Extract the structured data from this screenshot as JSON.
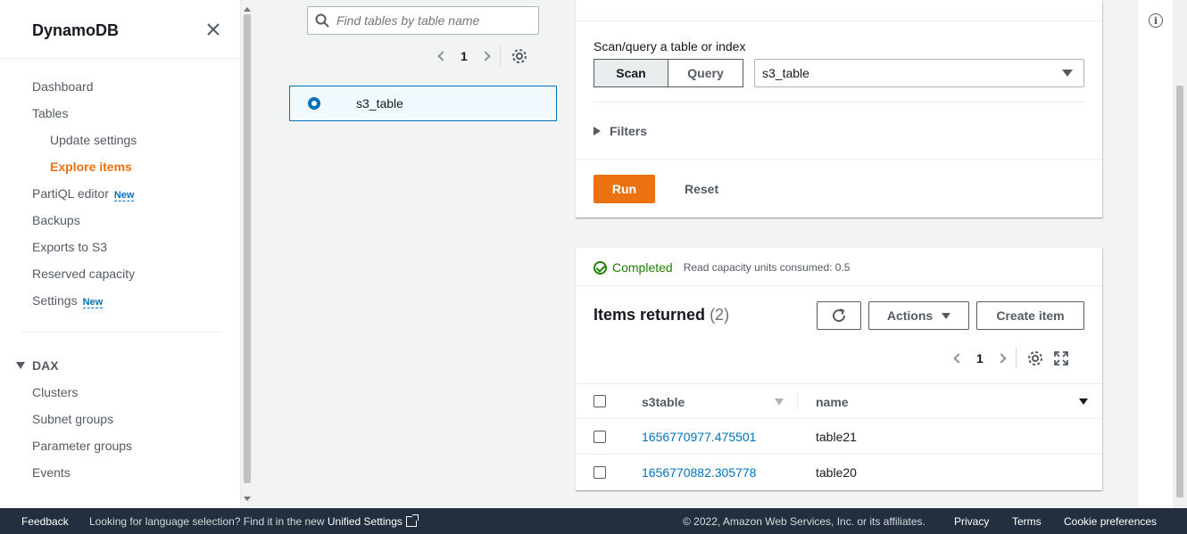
{
  "sidebar": {
    "title": "DynamoDB",
    "items": [
      {
        "label": "Dashboard"
      },
      {
        "label": "Tables"
      },
      {
        "label": "Update settings"
      },
      {
        "label": "Explore items"
      },
      {
        "label": "PartiQL editor",
        "badge": "New"
      },
      {
        "label": "Backups"
      },
      {
        "label": "Exports to S3"
      },
      {
        "label": "Reserved capacity"
      },
      {
        "label": "Settings",
        "badge": "New"
      }
    ],
    "dax_section": "DAX",
    "dax_items": [
      {
        "label": "Clusters"
      },
      {
        "label": "Subnet groups"
      },
      {
        "label": "Parameter groups"
      },
      {
        "label": "Events"
      }
    ]
  },
  "tables_panel": {
    "search_placeholder": "Find tables by table name",
    "page": "1",
    "selected_table": "s3_table"
  },
  "query_panel": {
    "label": "Scan/query a table or index",
    "scan_label": "Scan",
    "query_label": "Query",
    "selected_source": "s3_table",
    "filters_label": "Filters",
    "run_label": "Run",
    "reset_label": "Reset"
  },
  "results": {
    "status": "Completed",
    "rcu_text": "Read capacity units consumed: 0.5",
    "title": "Items returned",
    "count": "(2)",
    "actions_label": "Actions",
    "create_label": "Create item",
    "page": "1",
    "columns": [
      "s3table",
      "name"
    ],
    "rows": [
      {
        "s3table": "1656770977.475501",
        "name": "table21"
      },
      {
        "s3table": "1656770882.305778",
        "name": "table20"
      }
    ]
  },
  "footer": {
    "feedback": "Feedback",
    "lang_text": "Looking for language selection? Find it in the new",
    "unified_settings": "Unified Settings",
    "copyright": "© 2022, Amazon Web Services, Inc. or its affiliates.",
    "privacy": "Privacy",
    "terms": "Terms",
    "cookies": "Cookie preferences"
  },
  "colors": {
    "accent": "#ec7211",
    "link": "#0073bb",
    "success": "#1d8102",
    "footer_bg": "#232f3e"
  }
}
